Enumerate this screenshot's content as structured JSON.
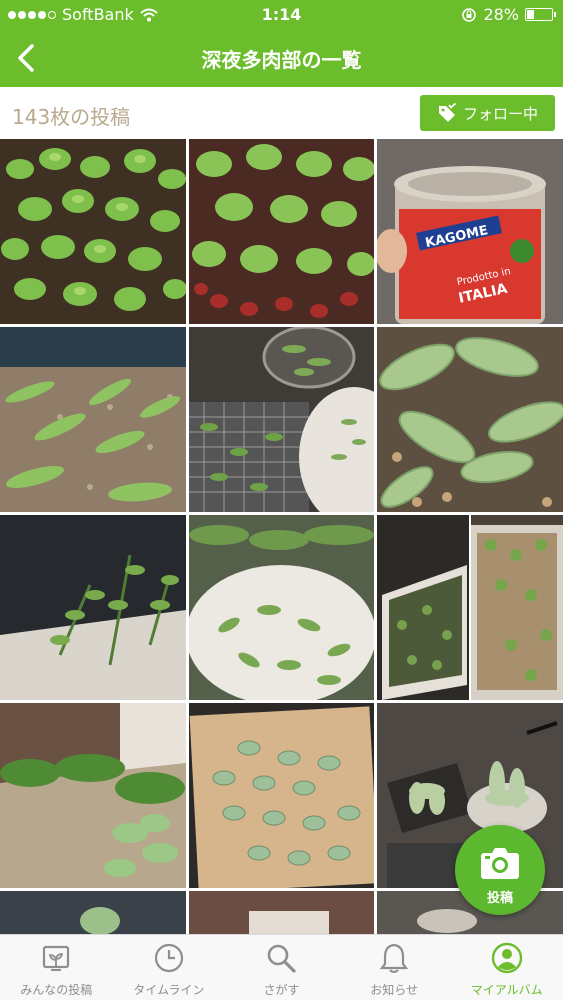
{
  "status_bar": {
    "carrier": "SoftBank",
    "time": "1:14",
    "battery": "28%",
    "battery_level": 0.28
  },
  "header": {
    "title": "深夜多肉部の一覧"
  },
  "subbar": {
    "post_count": "143枚の投稿",
    "follow_label": "フォロー中"
  },
  "fab": {
    "label": "投稿"
  },
  "tabs": [
    {
      "label": "みんなの投稿",
      "icon": "photo-plant-icon"
    },
    {
      "label": "タイムライン",
      "icon": "clock-icon"
    },
    {
      "label": "さがす",
      "icon": "search-icon"
    },
    {
      "label": "お知らせ",
      "icon": "bell-icon"
    },
    {
      "label": "マイアルバム",
      "icon": "profile-icon",
      "active": true
    }
  ],
  "colors": {
    "brand_green": "#6bbd2c",
    "count_text": "#b8a98c",
    "tab_inactive": "#8e8e8e"
  },
  "photos": [
    {
      "subject": "succulent cluster"
    },
    {
      "subject": "succulent cluster"
    },
    {
      "subject": "KAGOME tomato can",
      "can_brand": "KAGOME",
      "can_text_1": "Prodotto in",
      "can_text_2": "ITALIA"
    },
    {
      "subject": "leaf cuttings on gravel"
    },
    {
      "subject": "leaves drying on rack"
    },
    {
      "subject": "large succulent leaves"
    },
    {
      "subject": "sedum stems in tray"
    },
    {
      "subject": "leaves in white bowl"
    },
    {
      "subject": "planter box"
    },
    {
      "subject": "planter with sprouts"
    },
    {
      "subject": "succulent bed"
    },
    {
      "subject": "cuttings on board"
    },
    {
      "subject": "pots with rosettes"
    },
    {
      "subject": "partial row"
    }
  ]
}
